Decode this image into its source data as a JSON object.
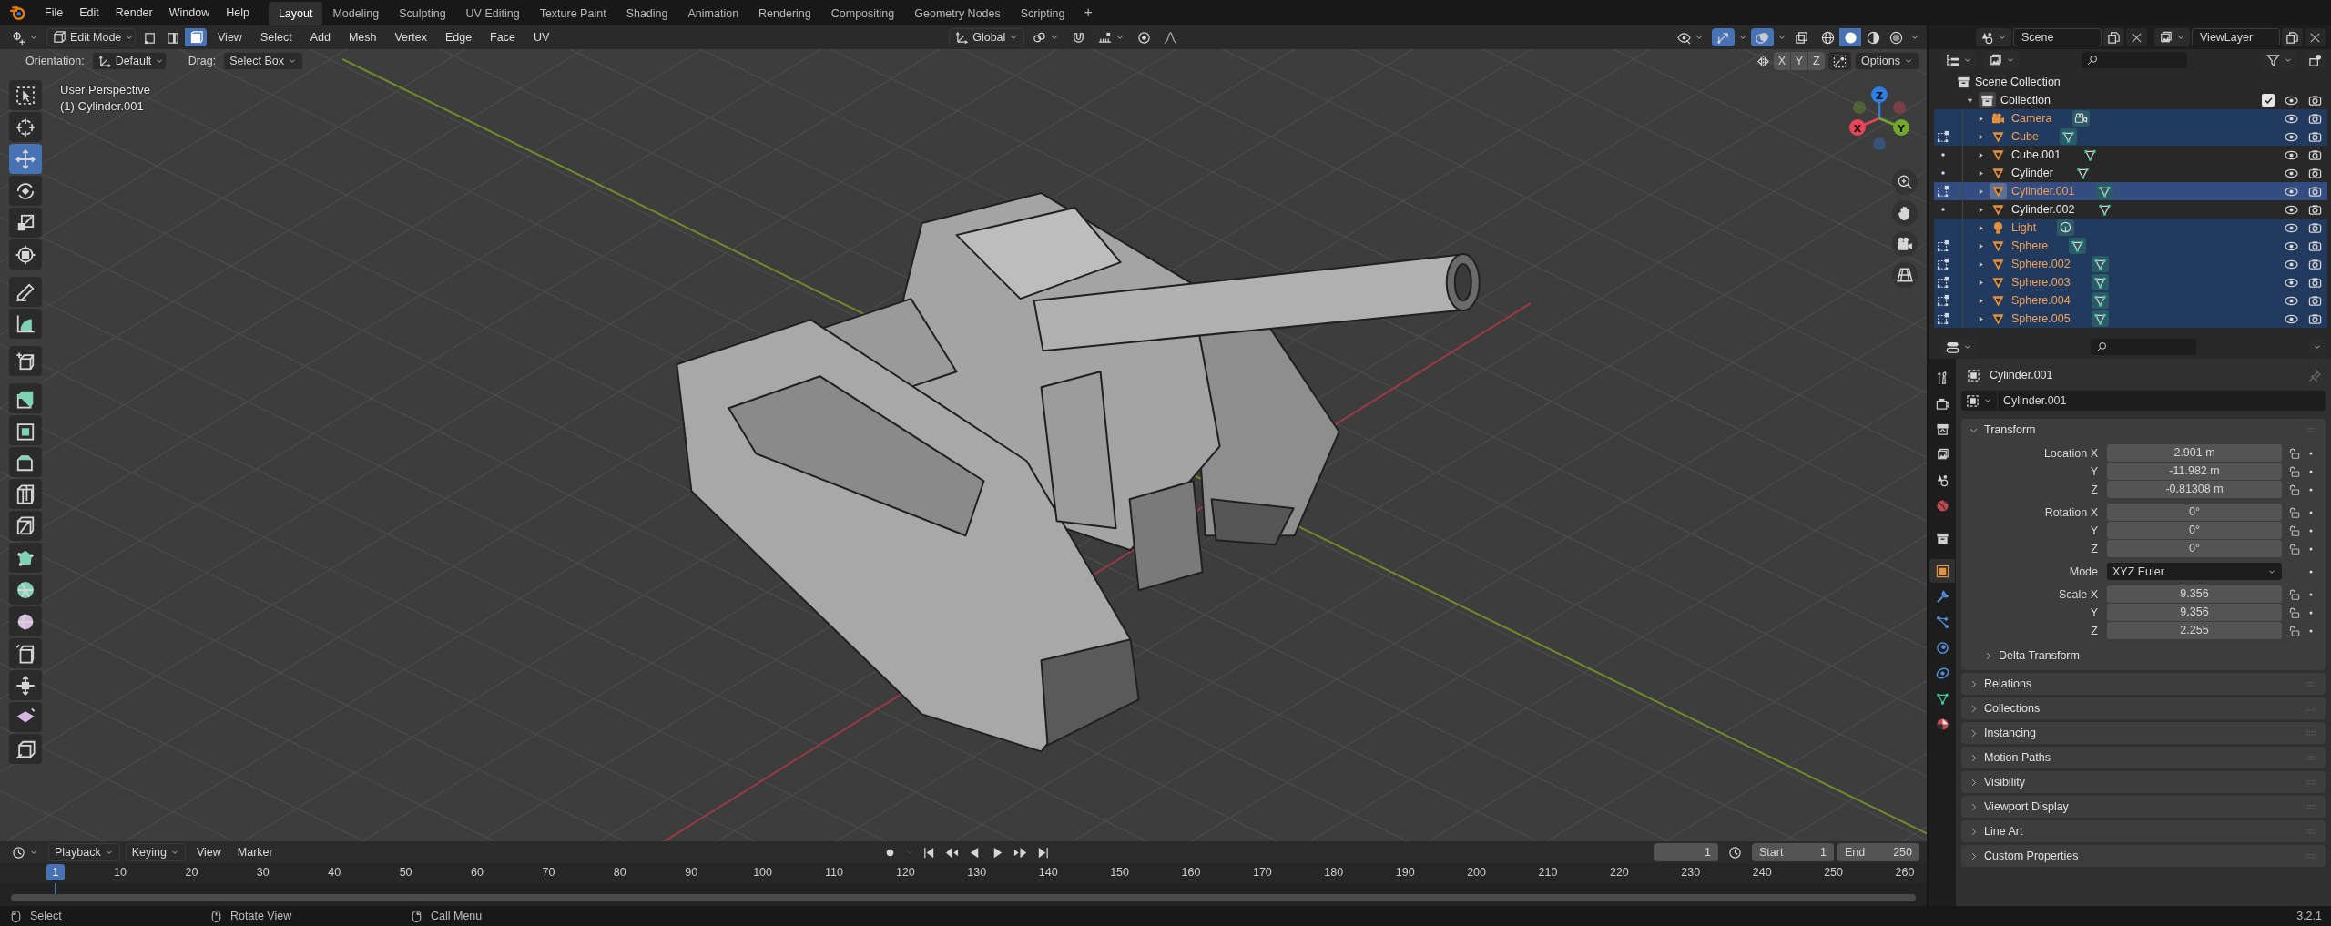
{
  "top_bar": {
    "menus": [
      "File",
      "Edit",
      "Render",
      "Window",
      "Help"
    ],
    "workspaces": [
      {
        "label": "Layout",
        "selected": true
      },
      {
        "label": "Modeling",
        "selected": false
      },
      {
        "label": "Sculpting",
        "selected": false
      },
      {
        "label": "UV Editing",
        "selected": false
      },
      {
        "label": "Texture Paint",
        "selected": false
      },
      {
        "label": "Shading",
        "selected": false
      },
      {
        "label": "Animation",
        "selected": false
      },
      {
        "label": "Rendering",
        "selected": false
      },
      {
        "label": "Compositing",
        "selected": false
      },
      {
        "label": "Geometry Nodes",
        "selected": false
      },
      {
        "label": "Scripting",
        "selected": false
      }
    ],
    "add_tab": "+"
  },
  "viewport": {
    "header": {
      "mode": "Edit Mode",
      "select_modes": [
        {
          "selected": false
        },
        {
          "selected": false
        },
        {
          "selected": true
        }
      ],
      "menus": [
        "View",
        "Select",
        "Add",
        "Mesh",
        "Vertex",
        "Edge",
        "Face",
        "UV"
      ],
      "orientation": "Global",
      "toggles": [
        {
          "on": false
        },
        {
          "on": false
        },
        {
          "on": true
        },
        {
          "on": true
        },
        {
          "on": false
        }
      ],
      "shading": [
        {
          "selected": false
        },
        {
          "selected": true
        },
        {
          "selected": false
        },
        {
          "selected": false
        }
      ]
    },
    "tool_settings": {
      "orientation_label": "Orientation:",
      "orientation": "Default",
      "drag_label": "Drag:",
      "drag": "Select Box",
      "axes": [
        "X",
        "Y",
        "Z"
      ],
      "options": "Options"
    },
    "overlay_text": [
      "User Perspective",
      "(1) Cylinder.001"
    ],
    "tools": [
      {
        "selected": false
      },
      {
        "selected": false
      },
      {
        "selected": true
      },
      {
        "selected": false
      },
      {
        "selected": false
      },
      {
        "selected": false
      },
      {
        "selected": false
      },
      {
        "selected": false
      },
      {
        "selected": false
      },
      {
        "selected": false
      },
      {
        "selected": false
      },
      {
        "selected": false
      },
      {
        "selected": false
      },
      {
        "selected": false
      },
      {
        "selected": false
      },
      {
        "selected": false
      },
      {
        "selected": false
      },
      {
        "selected": false
      },
      {
        "selected": false
      },
      {
        "selected": false
      },
      {
        "selected": false
      }
    ],
    "gizmo": [
      {
        "label": "Z",
        "color": "#2f7fe6"
      },
      {
        "label": "X",
        "color": "#e8455a"
      },
      {
        "label": "Y",
        "color": "#72a82a"
      }
    ]
  },
  "outliner": {
    "scene": "Scene",
    "view_layer": "ViewLayer",
    "root": "Scene Collection",
    "collection": {
      "label": "Collection",
      "checked": true,
      "children": [
        {
          "name": "Camera",
          "kind": "camera",
          "selected": true,
          "active": false
        },
        {
          "name": "Cube",
          "kind": "mesh",
          "edit_mode": true,
          "selected": true,
          "active": false
        },
        {
          "name": "Cube.001",
          "kind": "mesh",
          "edit_mode": false,
          "selected": false,
          "active": false
        },
        {
          "name": "Cylinder",
          "kind": "mesh",
          "edit_mode": false,
          "selected": false,
          "active": false
        },
        {
          "name": "Cylinder.001",
          "kind": "mesh",
          "edit_mode": true,
          "selected": true,
          "active": true
        },
        {
          "name": "Cylinder.002",
          "kind": "mesh",
          "edit_mode": false,
          "selected": false,
          "active": false
        },
        {
          "name": "Light",
          "kind": "light",
          "selected": true,
          "active": false
        },
        {
          "name": "Sphere",
          "kind": "mesh",
          "edit_mode": true,
          "selected": true,
          "active": false
        },
        {
          "name": "Sphere.002",
          "kind": "mesh",
          "edit_mode": true,
          "selected": true,
          "active": false
        },
        {
          "name": "Sphere.003",
          "kind": "mesh",
          "edit_mode": true,
          "selected": true,
          "active": false
        },
        {
          "name": "Sphere.004",
          "kind": "mesh",
          "edit_mode": true,
          "selected": true,
          "active": false
        },
        {
          "name": "Sphere.005",
          "kind": "mesh",
          "edit_mode": true,
          "selected": true,
          "active": false
        }
      ]
    }
  },
  "properties": {
    "tabs": [
      {
        "selected": false
      },
      {
        "selected": false
      },
      {
        "selected": false
      },
      {
        "selected": false
      },
      {
        "selected": false
      },
      {
        "selected": false
      },
      {
        "selected": false
      },
      {
        "selected": true
      },
      {
        "selected": false
      },
      {
        "selected": false
      },
      {
        "selected": false
      },
      {
        "selected": false
      },
      {
        "selected": false
      },
      {
        "selected": false
      }
    ],
    "title": "Cylinder.001",
    "object_name": "Cylinder.001",
    "transform": {
      "label": "Transform",
      "expanded": true,
      "groups": [
        [
          {
            "kind": "number",
            "label": "Location X",
            "value": "2.901 m"
          },
          {
            "kind": "number",
            "label": "Y",
            "value": "-11.982 m"
          },
          {
            "kind": "number",
            "label": "Z",
            "value": "-0.81308 m"
          }
        ],
        [
          {
            "kind": "number",
            "label": "Rotation X",
            "value": "0°"
          },
          {
            "kind": "number",
            "label": "Y",
            "value": "0°"
          },
          {
            "kind": "number",
            "label": "Z",
            "value": "0°"
          }
        ],
        [
          {
            "kind": "dropdown",
            "label": "Mode",
            "value": "XYZ Euler"
          }
        ],
        [
          {
            "kind": "number",
            "label": "Scale X",
            "value": "9.356"
          },
          {
            "kind": "number",
            "label": "Y",
            "value": "9.356"
          },
          {
            "kind": "number",
            "label": "Z",
            "value": "2.255"
          }
        ]
      ],
      "subpanel": {
        "label": "Delta Transform",
        "expanded": false
      }
    },
    "panels": [
      {
        "label": "Relations",
        "expanded": false
      },
      {
        "label": "Collections",
        "expanded": false
      },
      {
        "label": "Instancing",
        "expanded": false
      },
      {
        "label": "Motion Paths",
        "expanded": false
      },
      {
        "label": "Visibility",
        "expanded": false
      },
      {
        "label": "Viewport Display",
        "expanded": false
      },
      {
        "label": "Line Art",
        "expanded": false
      },
      {
        "label": "Custom Properties",
        "expanded": false
      }
    ]
  },
  "timeline": {
    "menus": [
      "Playback",
      "Keying",
      "View",
      "Marker"
    ],
    "current_frame": "1",
    "start_label": "Start",
    "start": "1",
    "end_label": "End",
    "end": "250",
    "playhead": "1",
    "ruler": [
      "10",
      "20",
      "30",
      "40",
      "50",
      "60",
      "70",
      "80",
      "90",
      "100",
      "110",
      "120",
      "130",
      "140",
      "150",
      "160",
      "170",
      "180",
      "190",
      "200",
      "210",
      "220",
      "230",
      "240",
      "250",
      "260"
    ]
  },
  "status_bar": {
    "hints": [
      "Select",
      "Rotate View",
      "Call Menu"
    ],
    "version": "3.2.1"
  }
}
